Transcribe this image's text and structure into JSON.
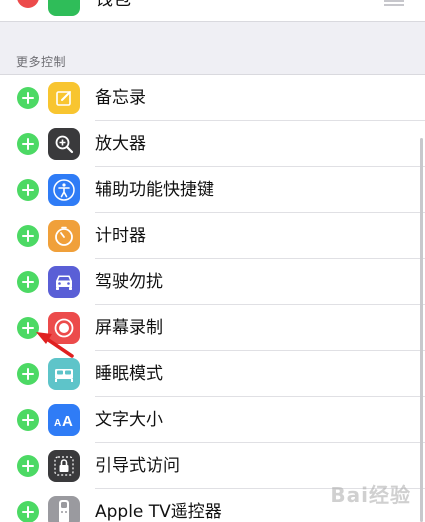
{
  "top_item": {
    "label": "钱包",
    "icon": "wallet-icon"
  },
  "section": {
    "header": "更多控制"
  },
  "items": [
    {
      "label": "备忘录",
      "icon": "notes-icon",
      "color": "#f8c530"
    },
    {
      "label": "放大器",
      "icon": "magnifier-icon",
      "color": "#3a3a3c"
    },
    {
      "label": "辅助功能快捷键",
      "icon": "accessibility-icon",
      "color": "#2f7cf6"
    },
    {
      "label": "计时器",
      "icon": "timer-icon",
      "color": "#f0a03a"
    },
    {
      "label": "驾驶勿扰",
      "icon": "car-icon",
      "color": "#5a5fd6"
    },
    {
      "label": "屏幕录制",
      "icon": "record-icon",
      "color": "#ec4b4b"
    },
    {
      "label": "睡眠模式",
      "icon": "bed-icon",
      "color": "#5ec4c9"
    },
    {
      "label": "文字大小",
      "icon": "text-size-icon",
      "color": "#2f7cf6"
    },
    {
      "label": "引导式访问",
      "icon": "lock-icon",
      "color": "#3a3a3c"
    },
    {
      "label": "Apple TV遥控器",
      "icon": "remote-icon",
      "color": "#9a9a9f"
    }
  ],
  "watermark": "Bai经验"
}
